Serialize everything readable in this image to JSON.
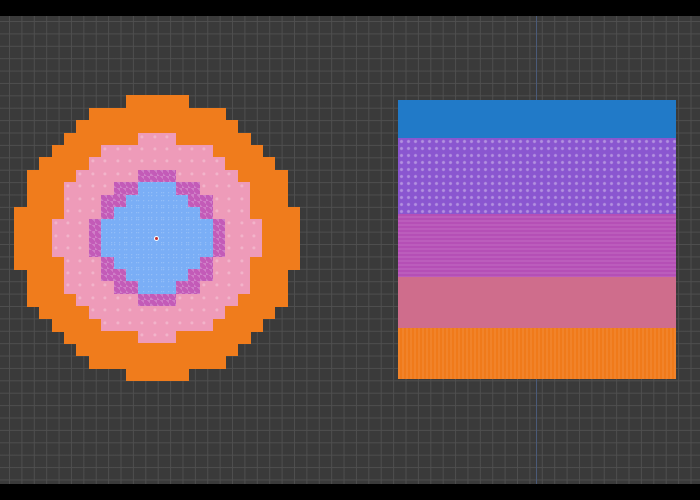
{
  "scene": {
    "background_color": "#3a3a3a",
    "grid_color": "#505050"
  },
  "tile_colors": {
    "orange": "#f07c1c",
    "pink": "#ee9bb9",
    "magenta": "#c35bb8",
    "blue": "#7aaef6"
  },
  "palette_stripes": [
    {
      "name": "blue",
      "color": "#217ac8"
    },
    {
      "name": "purple",
      "color": "#8a56d0"
    },
    {
      "name": "magenta",
      "color": "#b54fb6"
    },
    {
      "name": "pink",
      "color": "#cf6d8c"
    },
    {
      "name": "orange",
      "color": "#f07a1a"
    }
  ],
  "icons": [
    "pivot-point-icon"
  ]
}
